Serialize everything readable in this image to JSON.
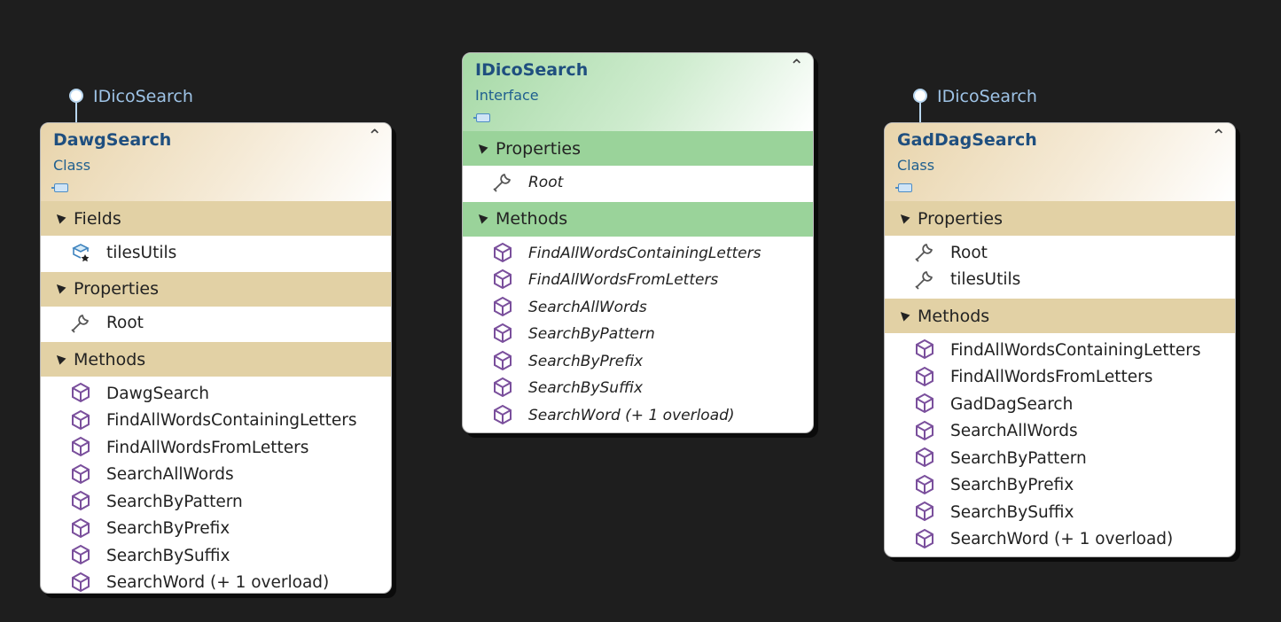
{
  "lollipops": [
    {
      "label": "IDicoSearch"
    },
    {
      "label": "IDicoSearch"
    }
  ],
  "classes": {
    "dawg": {
      "name": "DawgSearch",
      "kind": "Class",
      "sections": {
        "fields": {
          "title": "Fields",
          "items": [
            "tilesUtils"
          ]
        },
        "properties": {
          "title": "Properties",
          "items": [
            "Root"
          ]
        },
        "methods": {
          "title": "Methods",
          "items": [
            "DawgSearch",
            "FindAllWordsContainingLetters",
            "FindAllWordsFromLetters",
            "SearchAllWords",
            "SearchByPattern",
            "SearchByPrefix",
            "SearchBySuffix",
            "SearchWord (+ 1 overload)"
          ]
        }
      }
    },
    "idico": {
      "name": "IDicoSearch",
      "kind": "Interface",
      "sections": {
        "properties": {
          "title": "Properties",
          "items": [
            "Root"
          ]
        },
        "methods": {
          "title": "Methods",
          "items": [
            "FindAllWordsContainingLetters",
            "FindAllWordsFromLetters",
            "SearchAllWords",
            "SearchByPattern",
            "SearchByPrefix",
            "SearchBySuffix",
            "SearchWord (+ 1 overload)"
          ]
        }
      }
    },
    "gaddag": {
      "name": "GadDagSearch",
      "kind": "Class",
      "sections": {
        "properties": {
          "title": "Properties",
          "items": [
            "Root",
            "tilesUtils"
          ]
        },
        "methods": {
          "title": "Methods",
          "items": [
            "FindAllWordsContainingLetters",
            "FindAllWordsFromLetters",
            "GadDagSearch",
            "SearchAllWords",
            "SearchByPattern",
            "SearchByPrefix",
            "SearchBySuffix",
            "SearchWord (+ 1 overload)"
          ]
        }
      }
    }
  },
  "icons": {
    "field": "field-icon",
    "property": "wrench-icon",
    "method": "method-cube-icon",
    "collapse": "double-chevron-up-icon"
  },
  "colors": {
    "background": "#1e1e1e",
    "class_header": "#e2d1a5",
    "interface_header": "#9ad39a",
    "title_text": "#1f4f7f",
    "lollipop": "#9ec3e6"
  }
}
